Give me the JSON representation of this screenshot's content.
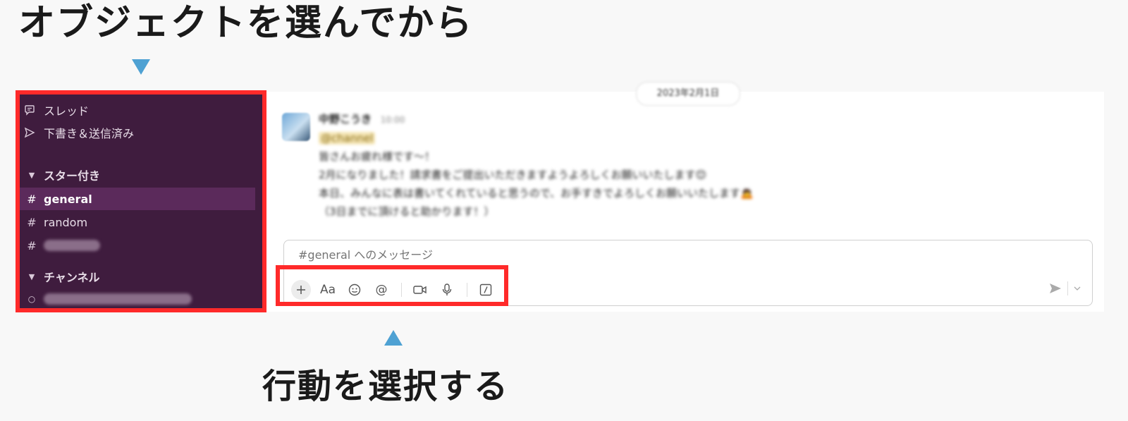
{
  "captions": {
    "top": "オブジェクトを選んでから",
    "bottom": "行動を選択する"
  },
  "colors": {
    "highlight": "#ff2a2a",
    "arrow": "#4ea1d3",
    "sidebar_bg": "#3f1c3e",
    "sidebar_active": "#5b2a5b"
  },
  "sidebar": {
    "items": [
      {
        "icon": "threads-icon",
        "label": "スレッド"
      },
      {
        "icon": "send-icon",
        "label": "下書き＆送信済み"
      }
    ],
    "starred_section": {
      "icon": "caret-down-icon",
      "label": "スター付き"
    },
    "starred_channels": [
      {
        "icon": "hash-icon",
        "label": "general",
        "active": true
      },
      {
        "icon": "hash-icon",
        "label": "random",
        "active": false
      },
      {
        "icon": "hash-icon",
        "label": "",
        "active": false
      }
    ],
    "channels_section": {
      "icon": "caret-down-icon",
      "label": "チャンネル"
    }
  },
  "message": {
    "date": "2023年2月1日",
    "author": "中野こうき",
    "time": "10:00",
    "mention": "@channel",
    "lines": [
      "皆さんお疲れ様です～！",
      "2月になりました！請求書をご提出いただきますようよろしくお願いいたします😊",
      "本日、みんなに表は書いてくれていると思うので、お手すきでよろしくお願いいたします🙇",
      "（3日までに頂けると助かります！）"
    ]
  },
  "composer": {
    "placeholder": "#general へのメッセージ",
    "toolbar": [
      {
        "icon": "plus-icon"
      },
      {
        "icon": "text-format-icon",
        "glyph": "Aa"
      },
      {
        "icon": "emoji-icon"
      },
      {
        "icon": "mention-icon",
        "glyph": "@"
      },
      {
        "icon": "video-icon"
      },
      {
        "icon": "microphone-icon"
      },
      {
        "icon": "slash-command-icon"
      }
    ],
    "send_icon": "send-icon",
    "send_options_icon": "chevron-down-icon"
  }
}
